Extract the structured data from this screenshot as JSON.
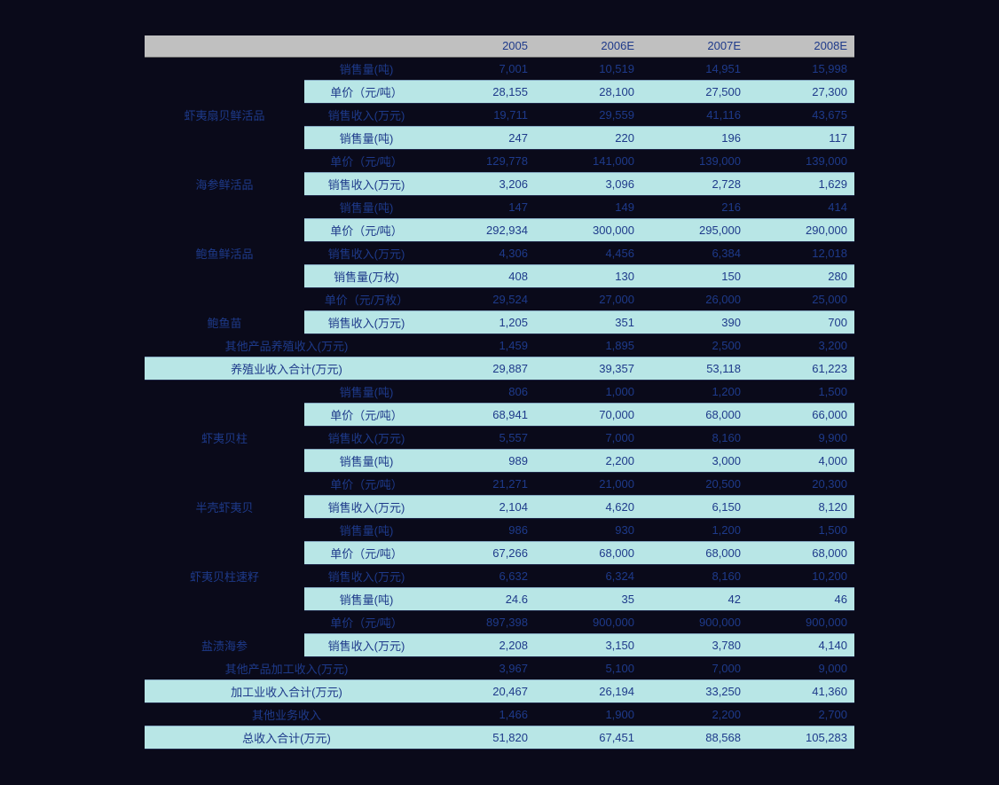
{
  "chart_data": {
    "type": "table",
    "title": "",
    "columns": [
      "",
      "",
      "2005",
      "2006E",
      "2007E",
      "2008E"
    ],
    "rows": [
      {
        "cat": "",
        "metric": "销售量(吨)",
        "vals": [
          "7,001",
          "10,519",
          "14,951",
          "15,998"
        ],
        "style": "dark"
      },
      {
        "cat": "",
        "metric": "单价（元/吨）",
        "vals": [
          "28,155",
          "28,100",
          "27,500",
          "27,300"
        ],
        "style": "cyan"
      },
      {
        "cat": "虾夷扇贝鲜活品",
        "metric": "销售收入(万元)",
        "vals": [
          "19,711",
          "29,559",
          "41,116",
          "43,675"
        ],
        "style": "dark",
        "catstart": true,
        "catspan": 1
      },
      {
        "cat": "",
        "metric": "销售量(吨)",
        "vals": [
          "247",
          "220",
          "196",
          "117"
        ],
        "style": "cyan"
      },
      {
        "cat": "",
        "metric": "单价（元/吨）",
        "vals": [
          "129,778",
          "141,000",
          "139,000",
          "139,000"
        ],
        "style": "dark"
      },
      {
        "cat": "海参鲜活品",
        "metric": "销售收入(万元)",
        "vals": [
          "3,206",
          "3,096",
          "2,728",
          "1,629"
        ],
        "style": "cyan",
        "catstart": true,
        "catspan": 1
      },
      {
        "cat": "",
        "metric": "销售量(吨)",
        "vals": [
          "147",
          "149",
          "216",
          "414"
        ],
        "style": "dark"
      },
      {
        "cat": "",
        "metric": "单价（元/吨）",
        "vals": [
          "292,934",
          "300,000",
          "295,000",
          "290,000"
        ],
        "style": "cyan"
      },
      {
        "cat": "鲍鱼鲜活品",
        "metric": "销售收入(万元)",
        "vals": [
          "4,306",
          "4,456",
          "6,384",
          "12,018"
        ],
        "style": "dark",
        "catstart": true,
        "catspan": 1
      },
      {
        "cat": "",
        "metric": "销售量(万枚)",
        "vals": [
          "408",
          "130",
          "150",
          "280"
        ],
        "style": "cyan"
      },
      {
        "cat": "",
        "metric": "单价（元/万枚）",
        "vals": [
          "29,524",
          "27,000",
          "26,000",
          "25,000"
        ],
        "style": "dark"
      },
      {
        "cat": "鲍鱼苗",
        "metric": "销售收入(万元)",
        "vals": [
          "1,205",
          "351",
          "390",
          "700"
        ],
        "style": "cyan",
        "catstart": true,
        "catspan": 1
      },
      {
        "cat": "其他产品养殖收入(万元)",
        "metric": "",
        "vals": [
          "1,459",
          "1,895",
          "2,500",
          "3,200"
        ],
        "style": "dark",
        "fullcat": true
      },
      {
        "cat": "养殖业收入合计(万元)",
        "metric": "",
        "vals": [
          "29,887",
          "39,357",
          "53,118",
          "61,223"
        ],
        "style": "cyan",
        "fullcat": true
      },
      {
        "cat": "",
        "metric": "销售量(吨)",
        "vals": [
          "806",
          "1,000",
          "1,200",
          "1,500"
        ],
        "style": "dark"
      },
      {
        "cat": "",
        "metric": "单价（元/吨）",
        "vals": [
          "68,941",
          "70,000",
          "68,000",
          "66,000"
        ],
        "style": "cyan"
      },
      {
        "cat": "虾夷贝柱",
        "metric": "销售收入(万元)",
        "vals": [
          "5,557",
          "7,000",
          "8,160",
          "9,900"
        ],
        "style": "dark",
        "catstart": true,
        "catspan": 1
      },
      {
        "cat": "",
        "metric": "销售量(吨)",
        "vals": [
          "989",
          "2,200",
          "3,000",
          "4,000"
        ],
        "style": "cyan"
      },
      {
        "cat": "",
        "metric": "单价（元/吨）",
        "vals": [
          "21,271",
          "21,000",
          "20,500",
          "20,300"
        ],
        "style": "dark"
      },
      {
        "cat": "半壳虾夷贝",
        "metric": "销售收入(万元)",
        "vals": [
          "2,104",
          "4,620",
          "6,150",
          "8,120"
        ],
        "style": "cyan",
        "catstart": true,
        "catspan": 1
      },
      {
        "cat": "",
        "metric": "销售量(吨)",
        "vals": [
          "986",
          "930",
          "1,200",
          "1,500"
        ],
        "style": "dark"
      },
      {
        "cat": "",
        "metric": "单价（元/吨）",
        "vals": [
          "67,266",
          "68,000",
          "68,000",
          "68,000"
        ],
        "style": "cyan"
      },
      {
        "cat": "虾夷贝柱速籽",
        "metric": "销售收入(万元)",
        "vals": [
          "6,632",
          "6,324",
          "8,160",
          "10,200"
        ],
        "style": "dark",
        "catstart": true,
        "catspan": 1
      },
      {
        "cat": "",
        "metric": "销售量(吨)",
        "vals": [
          "24.6",
          "35",
          "42",
          "46"
        ],
        "style": "cyan"
      },
      {
        "cat": "",
        "metric": "单价（元/吨）",
        "vals": [
          "897,398",
          "900,000",
          "900,000",
          "900,000"
        ],
        "style": "dark"
      },
      {
        "cat": "盐渍海参",
        "metric": "销售收入(万元)",
        "vals": [
          "2,208",
          "3,150",
          "3,780",
          "4,140"
        ],
        "style": "cyan",
        "catstart": true,
        "catspan": 1
      },
      {
        "cat": "其他产品加工收入(万元)",
        "metric": "",
        "vals": [
          "3,967",
          "5,100",
          "7,000",
          "9,000"
        ],
        "style": "dark",
        "fullcat": true
      },
      {
        "cat": "加工业收入合计(万元)",
        "metric": "",
        "vals": [
          "20,467",
          "26,194",
          "33,250",
          "41,360"
        ],
        "style": "cyan",
        "fullcat": true
      },
      {
        "cat": "其他业务收入",
        "metric": "",
        "vals": [
          "1,466",
          "1,900",
          "2,200",
          "2,700"
        ],
        "style": "dark",
        "fullcat": true
      },
      {
        "cat": "总收入合计(万元)",
        "metric": "",
        "vals": [
          "51,820",
          "67,451",
          "88,568",
          "105,283"
        ],
        "style": "cyan",
        "fullcat": true
      }
    ]
  }
}
